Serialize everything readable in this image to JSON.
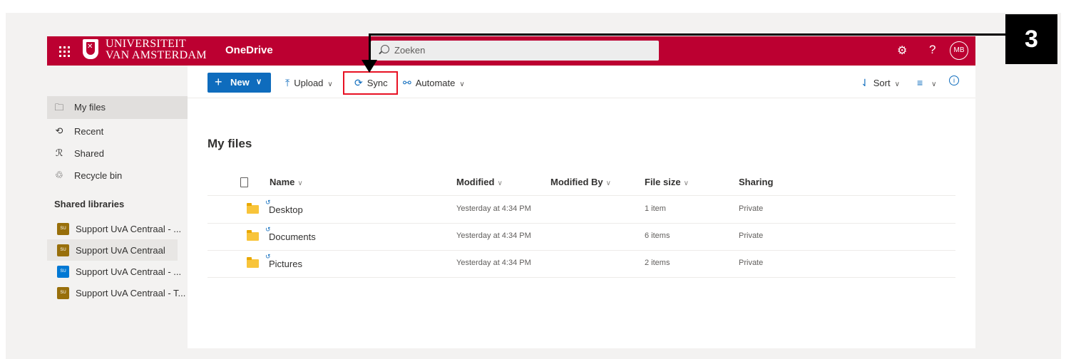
{
  "suite_bar": {
    "logo_line1": "UNIVERSITEIT",
    "logo_line2": "VAN AMSTERDAM",
    "app_name": "OneDrive",
    "search_placeholder": "Zoeken",
    "avatar_initials": "MB",
    "help_label": "?",
    "brand_color": "#bc0031"
  },
  "command_bar": {
    "new_label": "New",
    "upload_label": "Upload",
    "sync_label": "Sync",
    "automate_label": "Automate",
    "sort_label": "Sort",
    "highlight_color": "#e81123"
  },
  "left_nav": {
    "items": [
      {
        "label": "My files",
        "icon": "folder-icon",
        "active": true
      },
      {
        "label": "Recent",
        "icon": "history-icon"
      },
      {
        "label": "Shared",
        "icon": "people-icon"
      },
      {
        "label": "Recycle bin",
        "icon": "recycle-bin-icon"
      }
    ],
    "shared_heading": "Shared libraries",
    "libraries": [
      {
        "label": "Support UvA Centraal - ...",
        "badge": "SU",
        "color": "#986f0b"
      },
      {
        "label": "Support UvA Centraal",
        "badge": "SU",
        "color": "#986f0b"
      },
      {
        "label": "Support UvA Centraal - ...",
        "badge": "SU",
        "color": "#0078d4"
      },
      {
        "label": "Support UvA Centraal - T...",
        "badge": "SU",
        "color": "#986f0b"
      }
    ]
  },
  "main": {
    "title": "My files",
    "columns": {
      "name": "Name",
      "modified": "Modified",
      "modified_by": "Modified By",
      "file_size": "File size",
      "sharing": "Sharing"
    },
    "rows": [
      {
        "name": "Desktop",
        "modified": "Yesterday at 4:34 PM",
        "modified_by": "",
        "file_size": "1 item",
        "sharing": "Private"
      },
      {
        "name": "Documents",
        "modified": "Yesterday at 4:34 PM",
        "modified_by": "",
        "file_size": "6 items",
        "sharing": "Private"
      },
      {
        "name": "Pictures",
        "modified": "Yesterday at 4:34 PM",
        "modified_by": "",
        "file_size": "2 items",
        "sharing": "Private"
      }
    ]
  },
  "annotation": {
    "step_number": "3"
  }
}
